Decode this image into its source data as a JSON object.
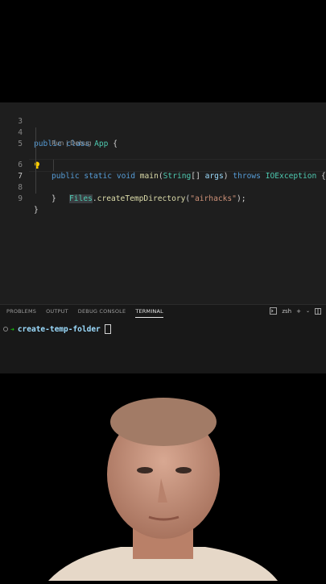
{
  "editor": {
    "lines": [
      {
        "num": "3"
      },
      {
        "num": "4",
        "kw": "public class ",
        "cls": "App",
        "rest": " {"
      },
      {
        "num": "5"
      },
      {
        "codelens": "Run | Debug"
      },
      {
        "num": "6",
        "kw": "public static void ",
        "fn": "main",
        "p1": "(",
        "type": "String",
        "p2": "[] ",
        "arg": "args",
        "p3": ") ",
        "kw2": "throws ",
        "exc": "IOException",
        "p4": " {"
      },
      {
        "num": "7",
        "cls": "Files",
        "p1": ".",
        "fn": "createTempDirectory",
        "p2": "(",
        "str": "\"airhacks\"",
        "p3": ");"
      },
      {
        "num": "8",
        "rest": "}"
      },
      {
        "num": "9",
        "rest": "}"
      }
    ]
  },
  "panel": {
    "tabs": [
      "PROBLEMS",
      "OUTPUT",
      "DEBUG CONSOLE",
      "TERMINAL"
    ],
    "shell": "zsh",
    "prompt_dir": "create-temp-folder"
  },
  "colors": {
    "accent": "#569cd6",
    "bg": "#1e1e1e"
  }
}
